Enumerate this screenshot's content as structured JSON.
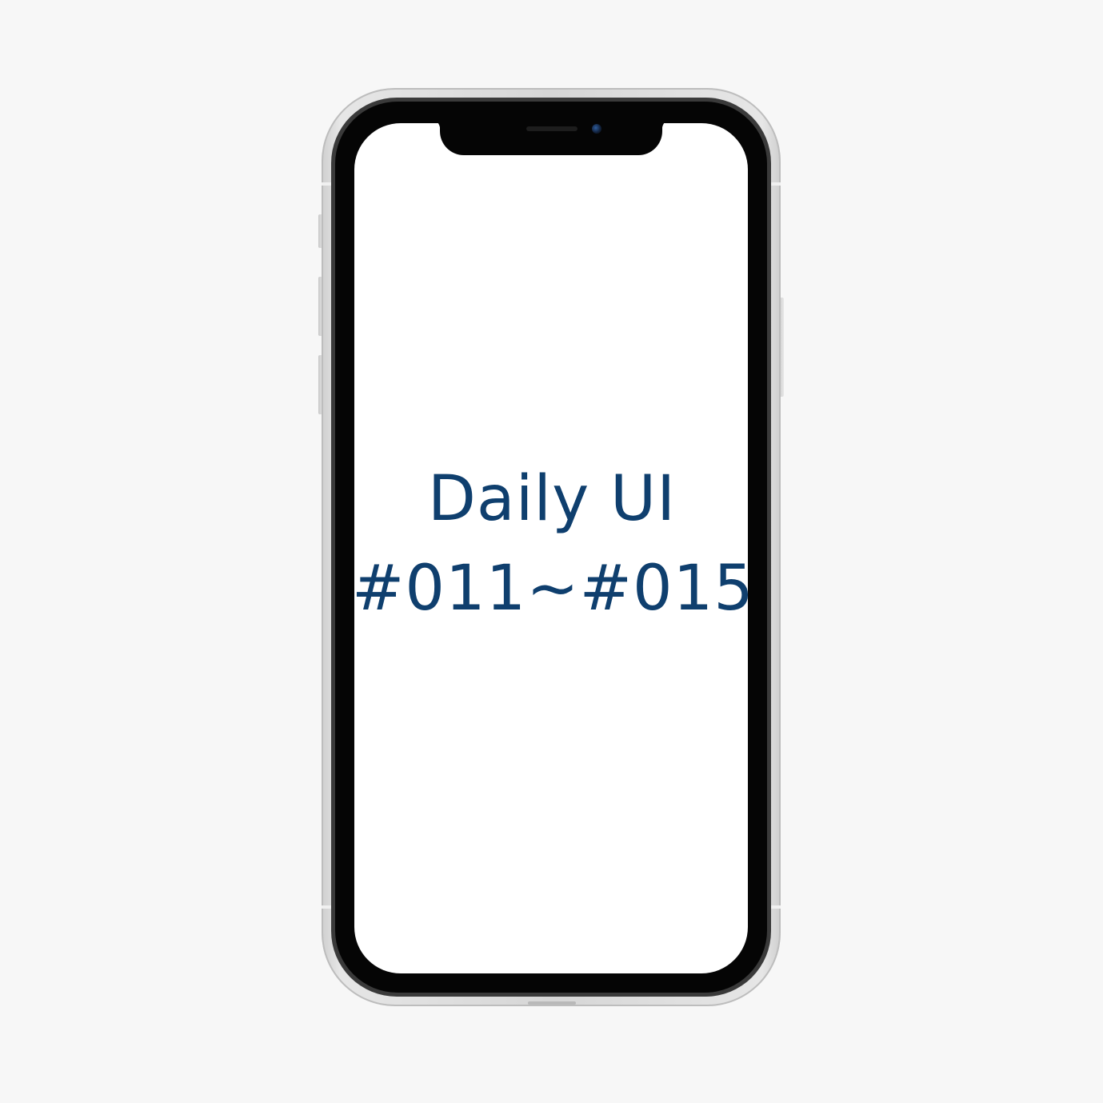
{
  "screen": {
    "title_line1": "Daily UI",
    "title_line2": "#011~#015"
  },
  "colors": {
    "background": "#f7f7f7",
    "screen": "#ffffff",
    "title_text": "#0f3f6e",
    "bezel": "#050505",
    "frame": "#d6d6d6"
  },
  "icons": {
    "camera": "front-camera-icon",
    "speaker": "earpiece-speaker-icon"
  }
}
